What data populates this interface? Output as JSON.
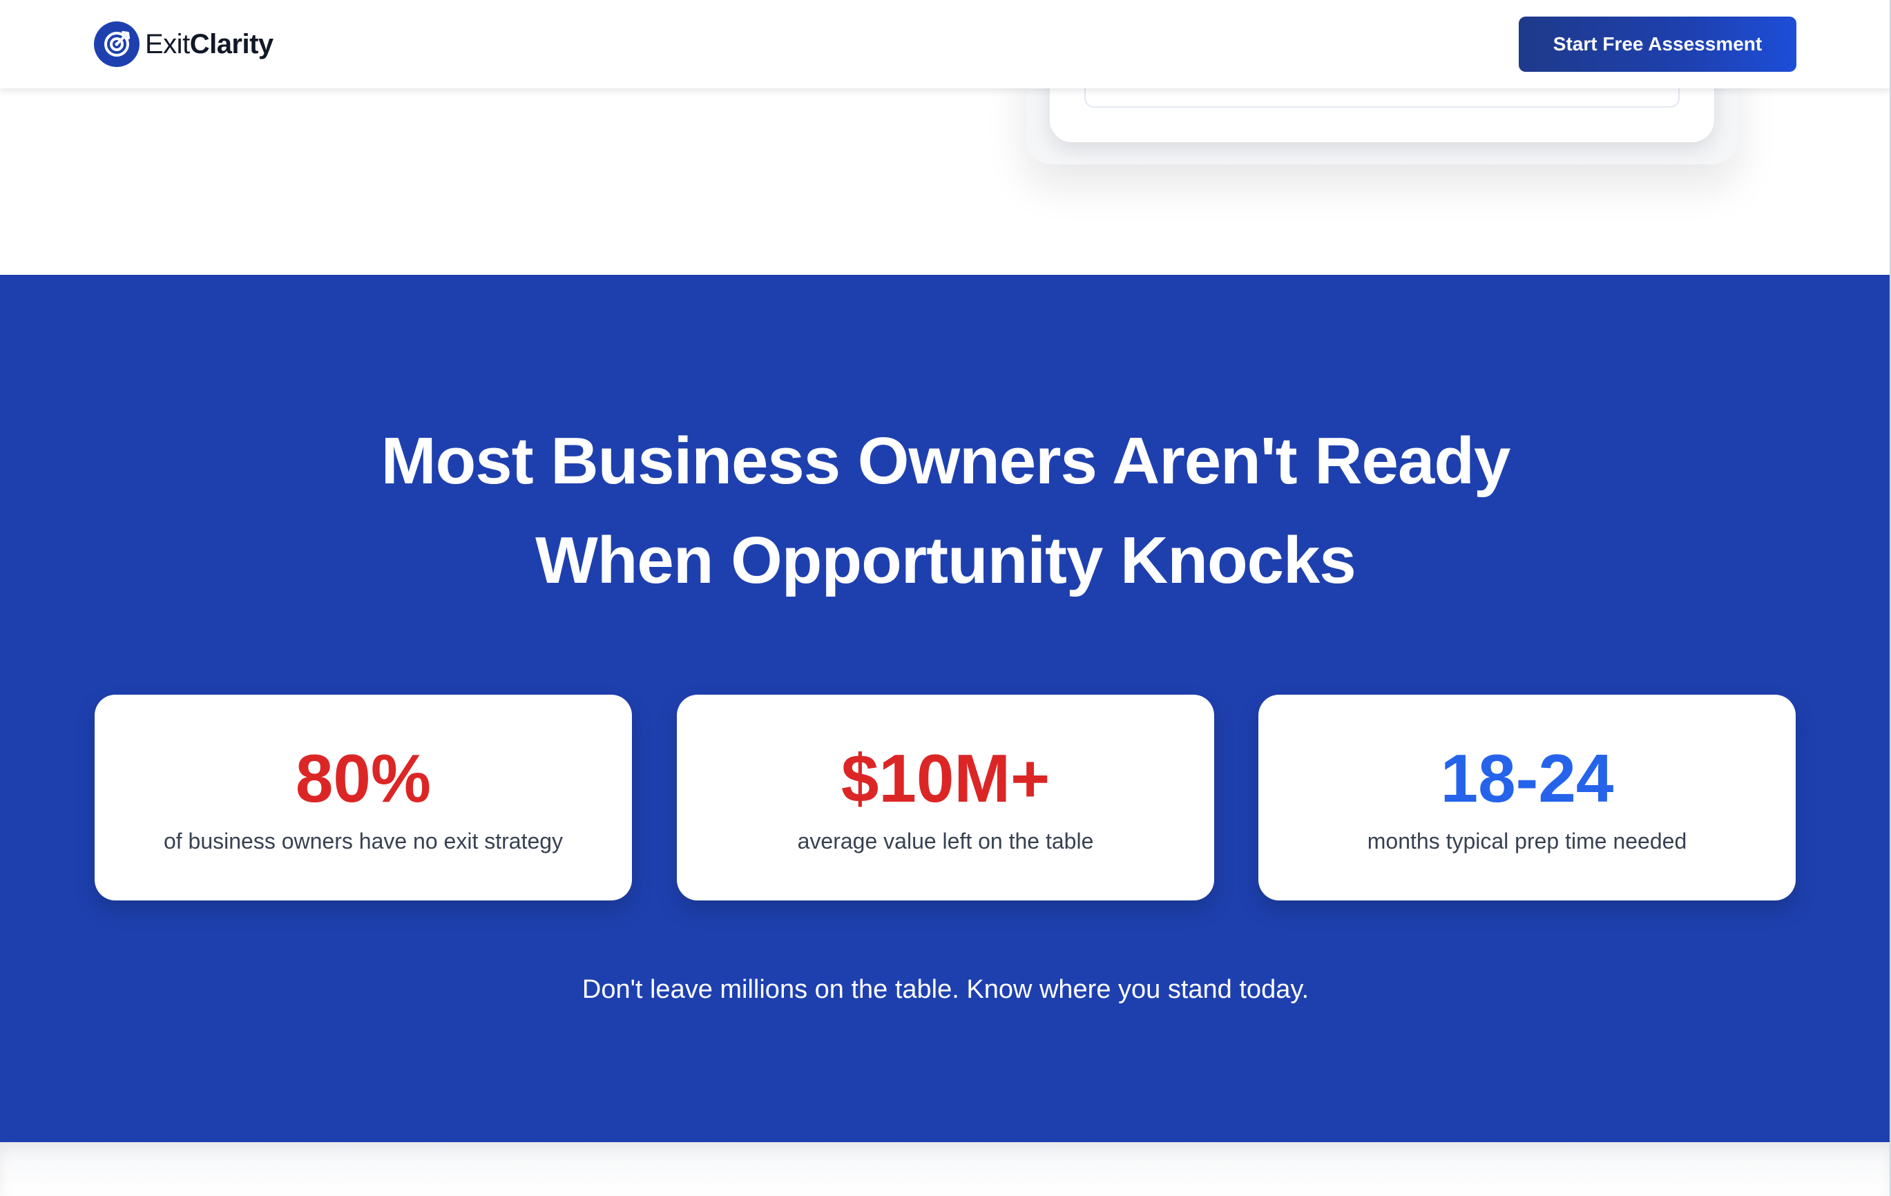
{
  "nav": {
    "logo_prefix": "Exit",
    "logo_bold": "Clarity",
    "logo_icon": "target-icon",
    "cta_label": "Start Free Assessment"
  },
  "stats_section": {
    "title_line1": "Most Business Owners Aren't Ready",
    "title_line2": "When Opportunity Knocks",
    "stats": [
      {
        "value": "80%",
        "label": "of business owners have no exit strategy",
        "color": "#dc2626"
      },
      {
        "value": "$10M+",
        "label": "average value left on the table",
        "color": "#dc2626"
      },
      {
        "value": "18-24",
        "label": "months typical prep time needed",
        "color": "#2563eb"
      }
    ],
    "tagline": "Don't leave millions on the table. Know where you stand today."
  },
  "colors": {
    "section_bg": "#1e40af",
    "cta_bg": "#1e3a8a",
    "accent_red": "#dc2626",
    "accent_blue": "#2563eb"
  }
}
